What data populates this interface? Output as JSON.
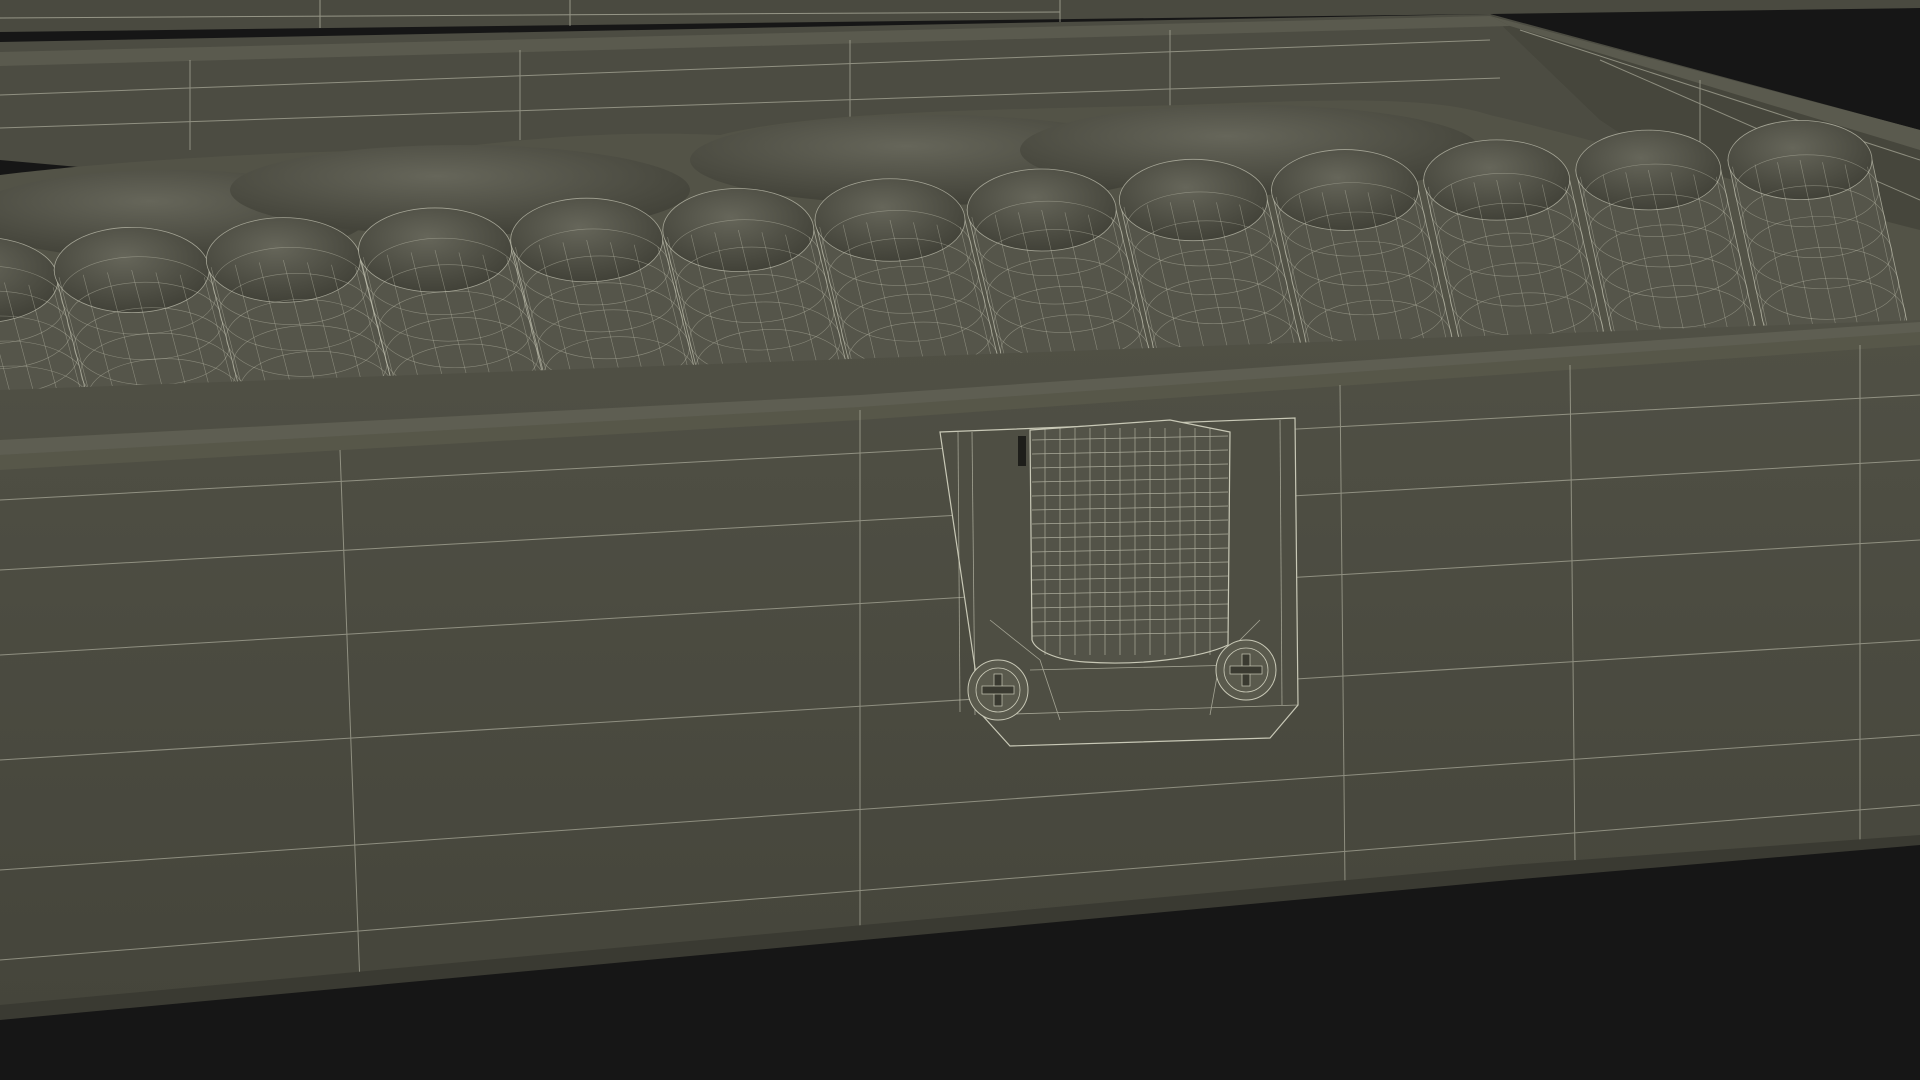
{
  "scene": {
    "subject": "wireframe-render-open-crate-with-cylindrical-rolls",
    "colors": {
      "background": "#161616",
      "box_front": "#4b4b40",
      "box_front_dark": "#3f3f35",
      "box_rim": "#55554a",
      "box_inner": "#45453b",
      "roll_fill": "#5a5a4d",
      "roll_shadow": "#33332b",
      "wire": "#c8c8b6",
      "latch_plate": "#4e4e43",
      "latch_tab": "#525247"
    },
    "roll_count_front_row": 13,
    "screw_icons": [
      "phillips-screw-icon",
      "phillips-screw-icon"
    ]
  }
}
